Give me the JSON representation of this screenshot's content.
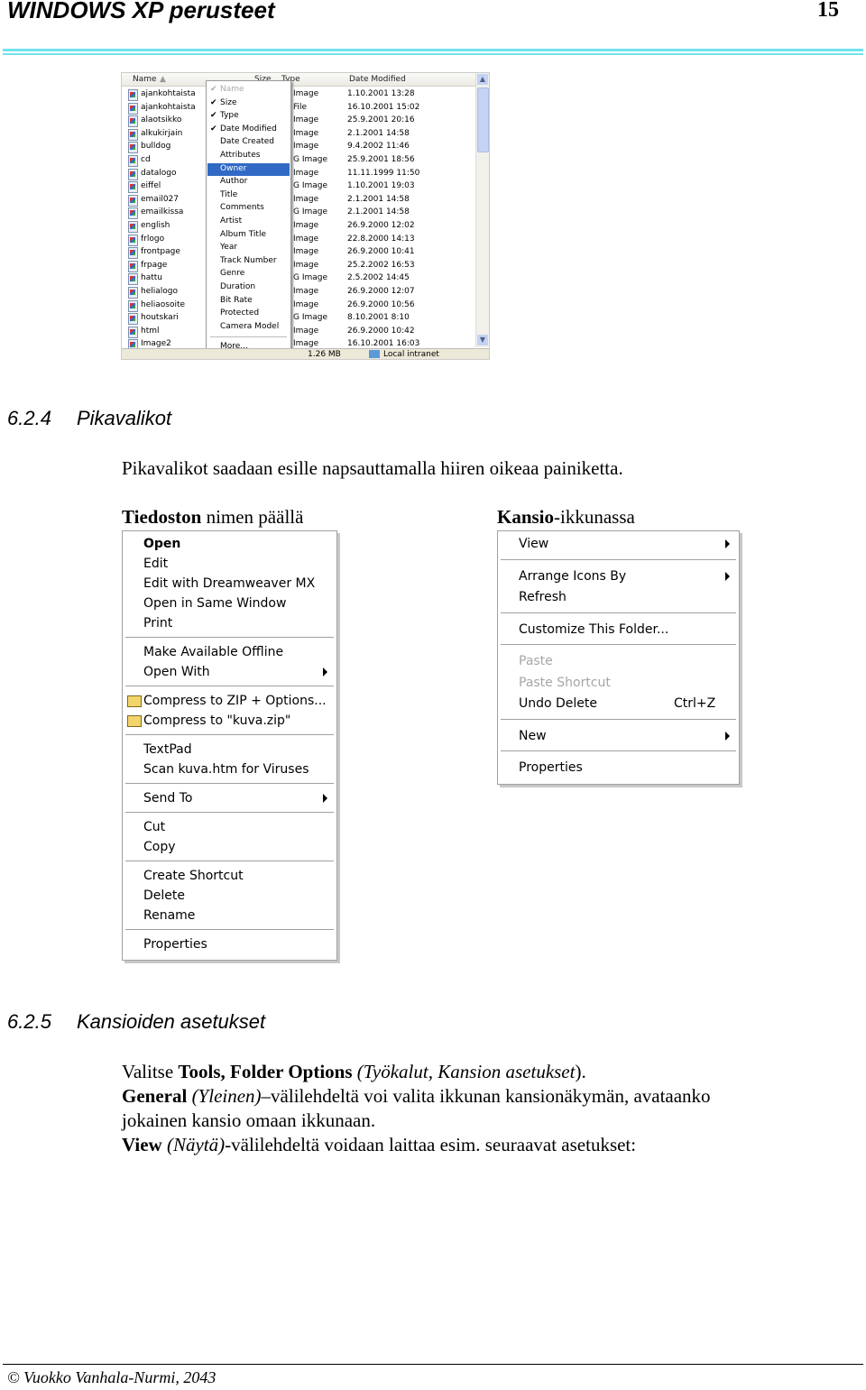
{
  "header": {
    "title": "WINDOWS XP  perusteet",
    "page_number": "15"
  },
  "explorer": {
    "columns": [
      "Name",
      "Size",
      "Type",
      "Date Modified"
    ],
    "rows": [
      [
        "ajankohtaista",
        "Image",
        "1.10.2001 13:28"
      ],
      [
        "ajankohtaista",
        "File",
        "16.10.2001 15:02"
      ],
      [
        "alaotsikko",
        "Image",
        "25.9.2001 20:16"
      ],
      [
        "alkukirjain",
        "Image",
        "2.1.2001 14:58"
      ],
      [
        "bulldog",
        "Image",
        "9.4.2002 11:46"
      ],
      [
        "cd",
        "G Image",
        "25.9.2001 18:56"
      ],
      [
        "datalogo",
        "Image",
        "11.11.1999 11:50"
      ],
      [
        "eiffel",
        "G Image",
        "1.10.2001 19:03"
      ],
      [
        "email027",
        "Image",
        "2.1.2001 14:58"
      ],
      [
        "emailkissa",
        "G Image",
        "2.1.2001 14:58"
      ],
      [
        "english",
        "Image",
        "26.9.2000 12:02"
      ],
      [
        "frlogo",
        "Image",
        "22.8.2000 14:13"
      ],
      [
        "frontpage",
        "Image",
        "26.9.2000 10:41"
      ],
      [
        "frpage",
        "Image",
        "25.2.2002 16:53"
      ],
      [
        "hattu",
        "G Image",
        "2.5.2002 14:45"
      ],
      [
        "helialogo",
        "Image",
        "26.9.2000 12:07"
      ],
      [
        "heliaosoite",
        "Image",
        "26.9.2000 10:56"
      ],
      [
        "houtskari",
        "G Image",
        "8.10.2001 8:10"
      ],
      [
        "html",
        "Image",
        "26.9.2000 10:42"
      ],
      [
        "Image2",
        "Image",
        "16.10.2001 16:03"
      ]
    ],
    "column_menu": [
      {
        "label": "Name",
        "checked": true,
        "disabled": true
      },
      {
        "label": "Size",
        "checked": true
      },
      {
        "label": "Type",
        "checked": true
      },
      {
        "label": "Date Modified",
        "checked": true
      },
      {
        "label": "Date Created"
      },
      {
        "label": "Attributes"
      },
      {
        "label": "Owner",
        "selected": true
      },
      {
        "label": "Author"
      },
      {
        "label": "Title"
      },
      {
        "label": "Comments"
      },
      {
        "label": "Artist"
      },
      {
        "label": "Album Title"
      },
      {
        "label": "Year"
      },
      {
        "label": "Track Number"
      },
      {
        "label": "Genre"
      },
      {
        "label": "Duration"
      },
      {
        "label": "Bit Rate"
      },
      {
        "label": "Protected"
      },
      {
        "label": "Camera Model"
      },
      {
        "sep": true
      },
      {
        "label": "More..."
      }
    ],
    "status": {
      "size": "1.26 MB",
      "zone": "Local intranet"
    }
  },
  "section1": {
    "number": "6.2.4",
    "title": "Pikavalikot",
    "intro": "Pikavalikot saadaan esille napsauttamalla hiiren oikeaa painiketta.",
    "left_caption_bold": "Tiedoston",
    "left_caption_rest": " nimen päällä",
    "right_caption_bold": "Kansio",
    "right_caption_rest": "-ikkunassa"
  },
  "file_menu": [
    {
      "label": "Open",
      "bold": true
    },
    {
      "label": "Edit"
    },
    {
      "label": "Edit with Dreamweaver MX"
    },
    {
      "label": "Open in Same Window"
    },
    {
      "label": "Print"
    },
    {
      "sep": true
    },
    {
      "label": "Make Available Offline"
    },
    {
      "label": "Open With",
      "submenu": true
    },
    {
      "sep": true
    },
    {
      "label": "Compress to ZIP + Options...",
      "icon": "zip-icon"
    },
    {
      "label": "Compress to \"kuva.zip\"",
      "icon": "zip-icon"
    },
    {
      "sep": true
    },
    {
      "label": "TextPad"
    },
    {
      "label": "Scan kuva.htm for Viruses"
    },
    {
      "sep": true
    },
    {
      "label": "Send To",
      "submenu": true
    },
    {
      "sep": true
    },
    {
      "label": "Cut"
    },
    {
      "label": "Copy"
    },
    {
      "sep": true
    },
    {
      "label": "Create Shortcut"
    },
    {
      "label": "Delete"
    },
    {
      "label": "Rename"
    },
    {
      "sep": true
    },
    {
      "label": "Properties"
    }
  ],
  "folder_menu": [
    {
      "label": "View",
      "submenu": true
    },
    {
      "sep": true
    },
    {
      "label": "Arrange Icons By",
      "submenu": true
    },
    {
      "label": "Refresh"
    },
    {
      "sep": true
    },
    {
      "label": "Customize This Folder..."
    },
    {
      "sep": true
    },
    {
      "label": "Paste",
      "disabled": true
    },
    {
      "label": "Paste Shortcut",
      "disabled": true
    },
    {
      "label": "Undo Delete",
      "shortcut": "Ctrl+Z"
    },
    {
      "sep": true
    },
    {
      "label": "New",
      "submenu": true
    },
    {
      "sep": true
    },
    {
      "label": "Properties"
    }
  ],
  "section2": {
    "number": "6.2.5",
    "title": "Kansioiden asetukset",
    "p1_a": "Valitse ",
    "p1_b": "Tools, Folder Options",
    "p1_c": " (Työkalut, Kansion asetukset",
    ").": "",
    "p1_d": ").",
    "p2_a": "General",
    "p2_b": " (Yleinen)",
    "p2_c": "–välilehdeltä voi valita ikkunan kansionäkymän, avataanko",
    "p3": "jokainen kansio omaan ikkunaan.",
    "p4_a": "View",
    "p4_b": " (Näytä)",
    "p4_c": "-välilehdeltä voidaan laittaa esim. seuraavat asetukset:"
  },
  "footer": {
    "text": "© Vuokko Vanhala-Nurmi, 2043"
  }
}
